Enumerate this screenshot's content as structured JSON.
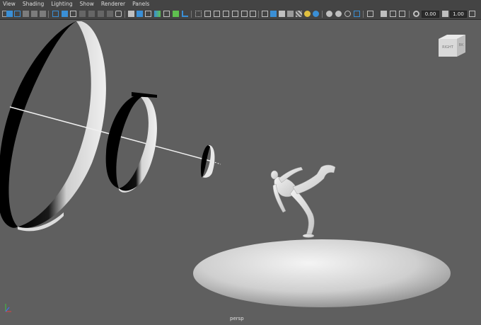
{
  "menu": [
    "View",
    "Shading",
    "Lighting",
    "Show",
    "Renderer",
    "Panels"
  ],
  "toolbar": {
    "exposure_value": "0.00",
    "gamma_value": "1.00",
    "colors": {
      "blue": "#3a8fd6",
      "green": "#5fbf4f",
      "light": "#bfbfbf",
      "dark": "#7c7c7c"
    }
  },
  "viewport": {
    "camera_name": "persp",
    "background": "#5f5f5f"
  },
  "viewcube": {
    "front_label": "RIGHT",
    "side_label": "BK"
  },
  "axis_indicator": {
    "x_color": "#e04040",
    "y_color": "#40c040",
    "z_color": "#4070ff"
  }
}
